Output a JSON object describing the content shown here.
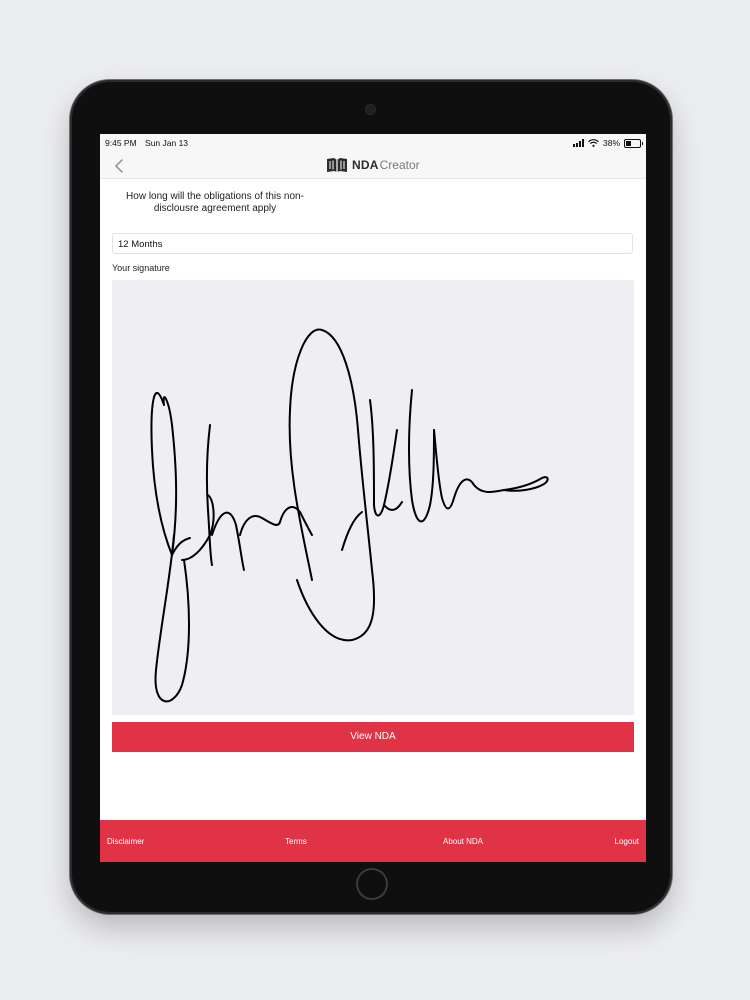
{
  "status_bar": {
    "time": "9:45 PM",
    "date": "Sun Jan 13",
    "battery_text": "38%",
    "battery_level": 0.38,
    "icons": [
      "signal-icon",
      "wifi-icon",
      "battery-icon"
    ]
  },
  "nav": {
    "back_icon": "chevron-left-icon",
    "logo_bold": "NDA",
    "logo_light": "Creator"
  },
  "form": {
    "question": "How long will the obligations of this non-disclousre agreement apply",
    "duration_value": "12 Months",
    "signature_label": "Your signature",
    "view_button": "View NDA"
  },
  "footer": {
    "links": [
      "Disclaimer",
      "Terms",
      "About NDA",
      "Logout"
    ]
  },
  "colors": {
    "accent": "#e03346",
    "pad_background": "#efeef3"
  }
}
